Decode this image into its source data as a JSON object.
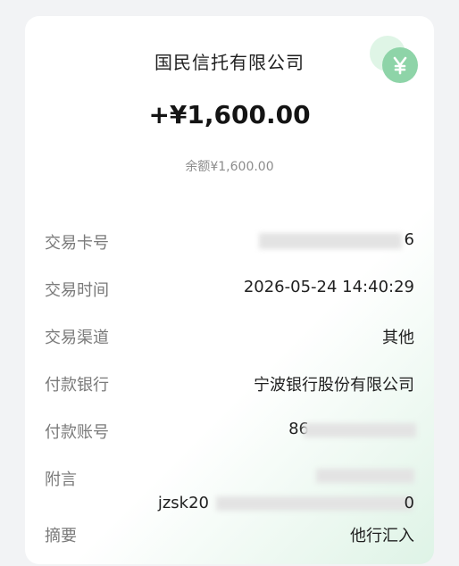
{
  "payer": "国民信托有限公司",
  "amount": "+¥1,600.00",
  "balance": "余额¥1,600.00",
  "badge_icon": "yen-icon",
  "accent_color": "#8ed4a8",
  "rows": {
    "card_no": {
      "label": "交易卡号",
      "value_tail": "6"
    },
    "time": {
      "label": "交易时间",
      "value": "2026-05-24 14:40:29"
    },
    "channel": {
      "label": "交易渠道",
      "value": "其他"
    },
    "bank": {
      "label": "付款银行",
      "value": "宁波银行股份有限公司"
    },
    "account": {
      "label": "付款账号",
      "value_head": "86"
    },
    "note": {
      "label": "附言",
      "value_head": "jzsk20",
      "value_tail": "0"
    },
    "summary": {
      "label": "摘要",
      "value": "他行汇入"
    }
  }
}
